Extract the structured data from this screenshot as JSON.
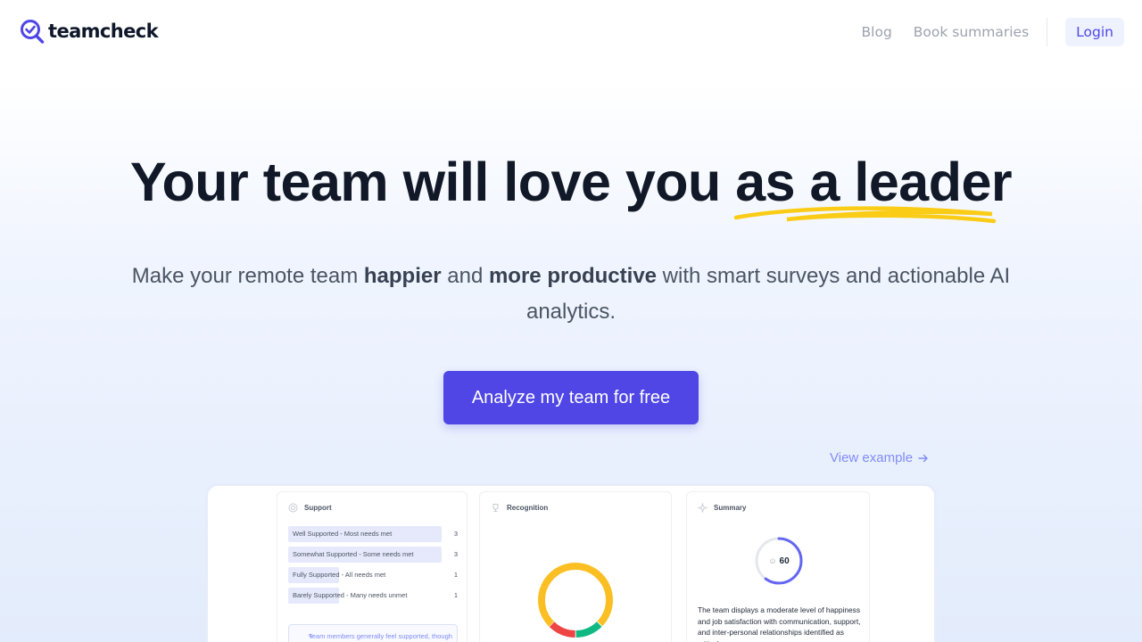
{
  "header": {
    "logo_text": "teamcheck",
    "nav": {
      "blog": "Blog",
      "book_summaries": "Book summaries",
      "login": "Login"
    }
  },
  "hero": {
    "title_part1": "Your team will love you ",
    "title_highlight": "as a leader",
    "subtitle_part1": "Make your remote team ",
    "subtitle_bold1": "happier",
    "subtitle_part2": " and ",
    "subtitle_bold2": "more productive",
    "subtitle_part3": " with smart surveys and actionable AI analytics.",
    "cta_label": "Analyze my team for free",
    "view_example": "View example"
  },
  "preview": {
    "support": {
      "title": "Support",
      "rows": [
        {
          "label": "Well Supported - Most needs met",
          "count": "3",
          "fraction": 1.0
        },
        {
          "label": "Somewhat Supported - Some needs met",
          "count": "3",
          "fraction": 1.0
        },
        {
          "label": "Fully Supported - All needs met",
          "count": "1",
          "fraction": 0.33
        },
        {
          "label": "Barely Supported - Many needs unmet",
          "count": "1",
          "fraction": 0.33
        }
      ],
      "note": "Team members generally feel supported, though concerns are raised about the"
    },
    "recognition": {
      "title": "Recognition",
      "donut": [
        {
          "color": "#fbbf24",
          "fraction": 0.75
        },
        {
          "color": "#10b981",
          "fraction": 0.125
        },
        {
          "color": "#ef4444",
          "fraction": 0.125
        }
      ]
    },
    "summary": {
      "title": "Summary",
      "score": "60",
      "score_fraction": 0.6,
      "text": "The team displays a moderate level of happiness and job satisfaction with communication, support, and inter-personal relationships identified as critical areas"
    }
  },
  "colors": {
    "accent": "#4f46e5",
    "underline": "#facc15"
  }
}
